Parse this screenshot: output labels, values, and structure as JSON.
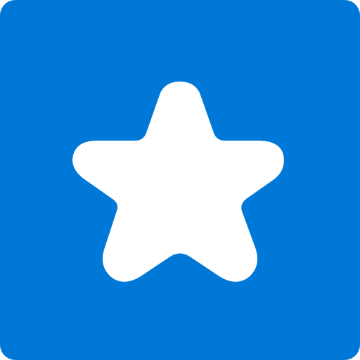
{
  "icon": {
    "name": "star-icon",
    "background_color": "#0078d7",
    "glyph_color": "#ffffff"
  }
}
